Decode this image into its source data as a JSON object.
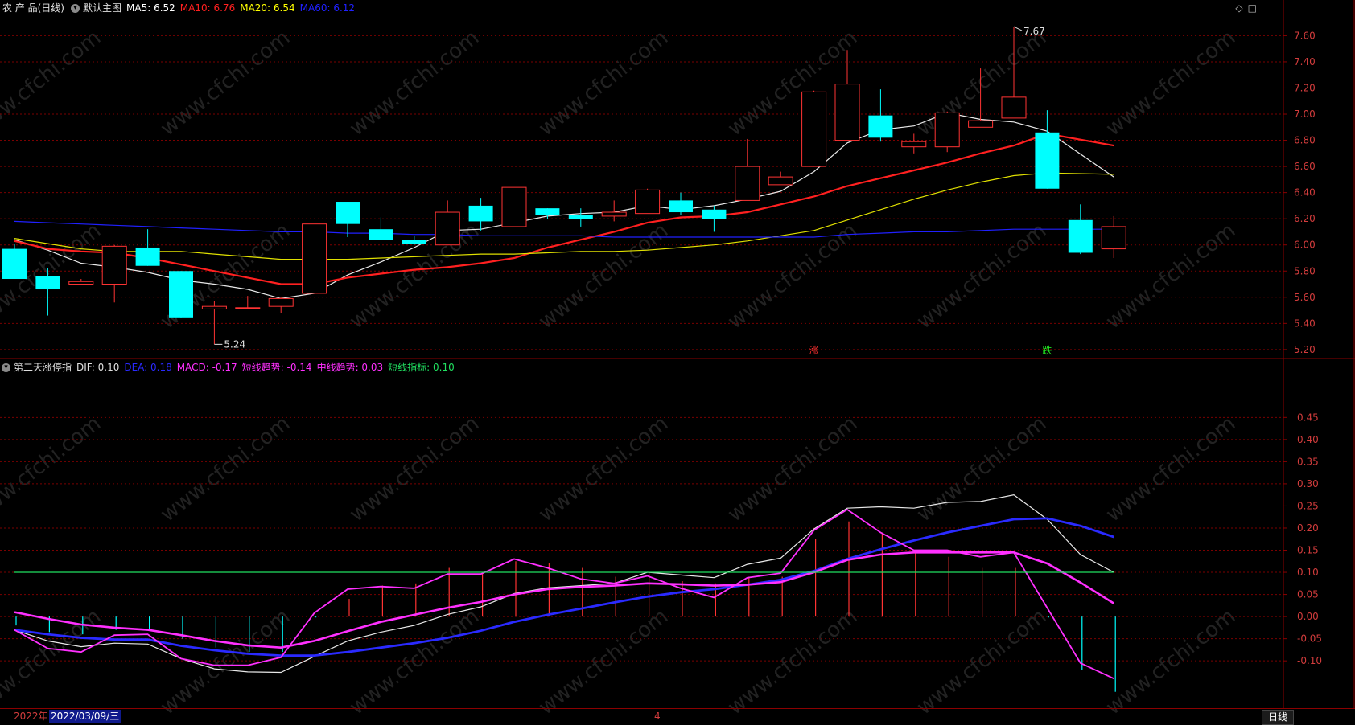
{
  "main_panel": {
    "name": "农 产 品(日线)",
    "template": "默认主图",
    "indicators": [
      {
        "label": "MA5: 6.52",
        "color": "#ffffff"
      },
      {
        "label": "MA10: 6.76",
        "color": "#ff2020"
      },
      {
        "label": "MA20: 6.54",
        "color": "#ffff00"
      },
      {
        "label": "MA60: 6.12",
        "color": "#2020ff"
      }
    ],
    "signals": [
      {
        "text": "涨",
        "color": "#ff3030",
        "index": 24
      },
      {
        "text": "跌",
        "color": "#20e020",
        "index": 31
      }
    ]
  },
  "sub_panel": {
    "name": "第二天涨停指",
    "indicators": [
      {
        "label": "DIF: 0.10",
        "color": "#e0e0e0"
      },
      {
        "label": "DEA: 0.18",
        "color": "#2a2aff"
      },
      {
        "label": "MACD: -0.17",
        "color": "#ff30ff"
      },
      {
        "label": "短线趋势: -0.14",
        "color": "#ff30ff"
      },
      {
        "label": "中线趋势: 0.03",
        "color": "#ff30ff"
      },
      {
        "label": "短线指标: 0.10",
        "color": "#20e060"
      }
    ]
  },
  "toolbar_icons": [
    "diamond-icon",
    "square-icon"
  ],
  "bottom": {
    "year": "2022年",
    "date": "2022/03/09/三",
    "month_marker": "4",
    "period": "日线"
  },
  "watermark": "www.cfchi.com",
  "colors": {
    "up": "#ff3333",
    "down": "#00ffff",
    "grid": "#7a0000",
    "axis_text": "#d23c3c"
  },
  "chart_data": [
    {
      "type": "candlestick",
      "title": "农 产 品(日线)",
      "ylim": [
        5.15,
        7.75
      ],
      "yticks": [
        5.2,
        5.4,
        5.6,
        5.8,
        6.0,
        6.2,
        6.4,
        6.6,
        6.8,
        7.0,
        7.2,
        7.4,
        7.6
      ],
      "annotations": [
        {
          "text": "5.24",
          "kind": "low",
          "index": 6,
          "value": 5.24
        },
        {
          "text": "7.67",
          "kind": "high",
          "index": 30,
          "value": 7.67
        }
      ],
      "candles": [
        {
          "o": 5.97,
          "h": 6.01,
          "c": 5.74,
          "l": 5.74
        },
        {
          "o": 5.76,
          "h": 5.82,
          "c": 5.66,
          "l": 5.46
        },
        {
          "o": 5.7,
          "h": 5.74,
          "c": 5.72,
          "l": 5.7
        },
        {
          "o": 5.7,
          "h": 6.0,
          "c": 5.99,
          "l": 5.56
        },
        {
          "o": 5.98,
          "h": 6.12,
          "c": 5.84,
          "l": 5.84
        },
        {
          "o": 5.8,
          "h": 5.8,
          "c": 5.44,
          "l": 5.44
        },
        {
          "o": 5.51,
          "h": 5.57,
          "c": 5.53,
          "l": 5.24
        },
        {
          "o": 5.52,
          "h": 5.61,
          "c": 5.52,
          "l": 5.52
        },
        {
          "o": 5.53,
          "h": 5.6,
          "c": 5.59,
          "l": 5.48
        },
        {
          "o": 5.63,
          "h": 6.16,
          "c": 6.16,
          "l": 5.63
        },
        {
          "o": 6.33,
          "h": 6.33,
          "c": 6.16,
          "l": 6.06
        },
        {
          "o": 6.12,
          "h": 6.21,
          "c": 6.04,
          "l": 6.04
        },
        {
          "o": 6.04,
          "h": 6.07,
          "c": 6.01,
          "l": 6.0
        },
        {
          "o": 6.0,
          "h": 6.34,
          "c": 6.25,
          "l": 6.0
        },
        {
          "o": 6.3,
          "h": 6.36,
          "c": 6.18,
          "l": 6.11
        },
        {
          "o": 6.14,
          "h": 6.44,
          "c": 6.44,
          "l": 6.14
        },
        {
          "o": 6.28,
          "h": 6.28,
          "c": 6.23,
          "l": 6.2
        },
        {
          "o": 6.23,
          "h": 6.28,
          "c": 6.2,
          "l": 6.14
        },
        {
          "o": 6.22,
          "h": 6.34,
          "c": 6.25,
          "l": 6.18
        },
        {
          "o": 6.24,
          "h": 6.43,
          "c": 6.42,
          "l": 6.24
        },
        {
          "o": 6.34,
          "h": 6.4,
          "c": 6.25,
          "l": 6.23
        },
        {
          "o": 6.27,
          "h": 6.3,
          "c": 6.2,
          "l": 6.1
        },
        {
          "o": 6.34,
          "h": 6.81,
          "c": 6.6,
          "l": 6.34
        },
        {
          "o": 6.46,
          "h": 6.56,
          "c": 6.52,
          "l": 6.46
        },
        {
          "o": 6.6,
          "h": 7.18,
          "c": 7.17,
          "l": 6.6
        },
        {
          "o": 6.8,
          "h": 7.49,
          "c": 7.23,
          "l": 6.8
        },
        {
          "o": 6.99,
          "h": 7.19,
          "c": 6.82,
          "l": 6.79
        },
        {
          "o": 6.75,
          "h": 6.85,
          "c": 6.79,
          "l": 6.7
        },
        {
          "o": 6.75,
          "h": 7.02,
          "c": 7.01,
          "l": 6.71
        },
        {
          "o": 6.9,
          "h": 7.35,
          "c": 6.95,
          "l": 6.9
        },
        {
          "o": 6.97,
          "h": 7.67,
          "c": 7.13,
          "l": 6.97
        },
        {
          "o": 6.86,
          "h": 7.03,
          "c": 6.43,
          "l": 6.43
        },
        {
          "o": 6.19,
          "h": 6.31,
          "c": 5.94,
          "l": 5.93
        },
        {
          "o": 5.97,
          "h": 6.22,
          "c": 6.14,
          "l": 5.9
        }
      ],
      "series": [
        {
          "name": "MA5",
          "color": "#e8e8e8",
          "values": [
            6.04,
            5.96,
            5.86,
            5.83,
            5.79,
            5.73,
            5.7,
            5.66,
            5.59,
            5.63,
            5.77,
            5.87,
            5.98,
            6.11,
            6.12,
            6.17,
            6.22,
            6.24,
            6.25,
            6.3,
            6.27,
            6.3,
            6.35,
            6.41,
            6.56,
            6.78,
            6.88,
            6.91,
            7.01,
            6.96,
            6.94,
            6.87,
            null,
            6.52
          ]
        },
        {
          "name": "MA10",
          "color": "#ff2020",
          "values": [
            6.03,
            5.97,
            5.95,
            5.94,
            5.9,
            5.85,
            5.8,
            5.75,
            5.7,
            5.7,
            5.75,
            5.78,
            5.81,
            5.83,
            5.86,
            5.9,
            5.98,
            6.04,
            6.1,
            6.17,
            6.21,
            6.22,
            6.25,
            6.31,
            6.37,
            6.45,
            6.51,
            6.57,
            6.63,
            6.7,
            6.76,
            6.85,
            null,
            6.76
          ]
        },
        {
          "name": "MA20",
          "color": "#e0e000",
          "values": [
            6.05,
            6.01,
            5.97,
            5.95,
            5.95,
            5.95,
            5.93,
            5.91,
            5.89,
            5.89,
            5.89,
            5.9,
            5.91,
            5.92,
            5.93,
            5.93,
            5.94,
            5.95,
            5.95,
            5.96,
            5.98,
            6.0,
            6.03,
            6.07,
            6.11,
            6.19,
            6.27,
            6.35,
            6.42,
            6.48,
            6.53,
            6.55,
            null,
            6.54
          ]
        },
        {
          "name": "MA60",
          "color": "#2020ff",
          "values": [
            6.18,
            6.17,
            6.16,
            6.15,
            6.14,
            6.13,
            6.12,
            6.11,
            6.1,
            6.1,
            6.09,
            6.09,
            6.08,
            6.08,
            6.07,
            6.07,
            6.07,
            6.07,
            6.06,
            6.06,
            6.06,
            6.06,
            6.06,
            6.06,
            6.06,
            6.08,
            6.09,
            6.1,
            6.1,
            6.11,
            6.12,
            6.12,
            null,
            6.12
          ]
        }
      ]
    },
    {
      "type": "line",
      "title": "第二天涨停指",
      "ylim": [
        -0.205,
        0.545
      ],
      "yticks": [
        -0.1,
        -0.05,
        0.0,
        0.05,
        0.1,
        0.15,
        0.2,
        0.25,
        0.3,
        0.35,
        0.4,
        0.45
      ],
      "series": [
        {
          "name": "DIF",
          "color": "#e8e8e8",
          "values": [
            -0.03,
            -0.055,
            -0.068,
            -0.06,
            -0.062,
            -0.095,
            -0.118,
            -0.125,
            -0.126,
            -0.09,
            -0.055,
            -0.035,
            -0.02,
            0.005,
            0.022,
            0.052,
            0.065,
            0.07,
            0.075,
            0.1,
            0.094,
            0.088,
            0.118,
            0.132,
            0.198,
            0.245,
            0.248,
            0.245,
            0.258,
            0.26,
            0.275,
            0.22,
            0.14,
            0.1
          ]
        },
        {
          "name": "DEA",
          "color": "#2a2aff",
          "values": [
            -0.03,
            -0.04,
            -0.048,
            -0.052,
            -0.052,
            -0.066,
            -0.076,
            -0.084,
            -0.088,
            -0.088,
            -0.08,
            -0.07,
            -0.06,
            -0.048,
            -0.032,
            -0.012,
            0.004,
            0.018,
            0.032,
            0.045,
            0.055,
            0.062,
            0.072,
            0.083,
            0.103,
            0.13,
            0.152,
            0.172,
            0.19,
            0.205,
            0.22,
            0.222,
            0.205,
            0.18
          ]
        },
        {
          "name": "短线趋势",
          "color": "#ff30ff",
          "values": [
            -0.03,
            -0.072,
            -0.08,
            -0.042,
            -0.04,
            -0.095,
            -0.11,
            -0.11,
            -0.092,
            0.008,
            0.062,
            0.068,
            0.064,
            0.096,
            0.096,
            0.13,
            0.11,
            0.085,
            0.075,
            0.092,
            0.064,
            0.043,
            0.088,
            0.098,
            0.195,
            0.242,
            0.19,
            0.15,
            0.15,
            0.135,
            0.145,
            0.02,
            -0.105,
            -0.14
          ]
        },
        {
          "name": "中线趋势",
          "color": "#ff30ff",
          "values": [
            0.01,
            -0.005,
            -0.018,
            -0.025,
            -0.03,
            -0.042,
            -0.055,
            -0.065,
            -0.07,
            -0.055,
            -0.033,
            -0.012,
            0.004,
            0.02,
            0.033,
            0.05,
            0.062,
            0.067,
            0.07,
            0.075,
            0.073,
            0.07,
            0.072,
            0.078,
            0.1,
            0.128,
            0.14,
            0.145,
            0.145,
            0.145,
            0.145,
            0.12,
            0.077,
            0.03
          ]
        },
        {
          "name": "短线指标",
          "color": "#20e060",
          "values": [
            0.1,
            0.1,
            0.1,
            0.1,
            0.1,
            0.1,
            0.1,
            0.1,
            0.1,
            0.1,
            0.1,
            0.1,
            0.1,
            0.1,
            0.1,
            0.1,
            0.1,
            0.1,
            0.1,
            0.1,
            0.1,
            0.1,
            0.1,
            0.1,
            0.1,
            0.1,
            0.1,
            0.1,
            0.1,
            0.1,
            0.1,
            0.1,
            0.1,
            0.1
          ]
        }
      ],
      "bars": {
        "name": "MACD",
        "up_color": "#ff3333",
        "down_color": "#00ffff",
        "values": [
          -0.02,
          -0.035,
          -0.04,
          -0.03,
          -0.03,
          -0.05,
          -0.07,
          -0.08,
          -0.08,
          -0.002,
          0.04,
          0.07,
          0.075,
          0.11,
          0.1,
          0.125,
          0.12,
          0.11,
          0.09,
          0.1,
          0.08,
          0.075,
          0.09,
          0.09,
          0.175,
          0.215,
          0.19,
          0.15,
          0.135,
          0.11,
          0.11,
          -0.002,
          -0.12,
          -0.17
        ]
      }
    }
  ]
}
